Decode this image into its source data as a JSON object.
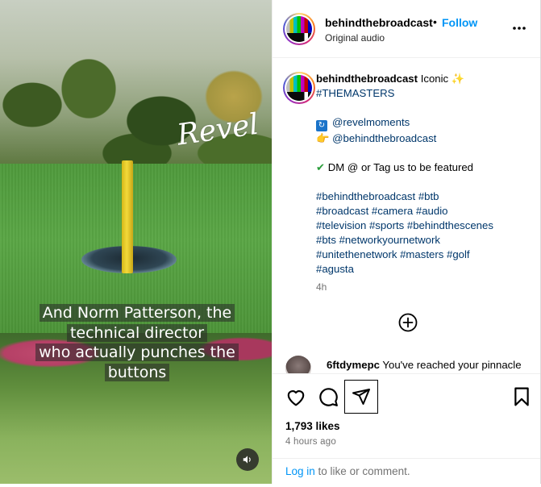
{
  "video": {
    "watermark": "Revel",
    "caption_lines": [
      "And Norm Patterson, the",
      "technical director",
      "who actually punches the",
      "buttons"
    ],
    "mute_icon": "speaker-icon"
  },
  "header": {
    "username": "behindthebroadcast",
    "separator": "•",
    "follow_label": "Follow",
    "subtitle": "Original audio",
    "more_icon": "more-options-icon"
  },
  "caption": {
    "username": "behindthebroadcast",
    "first_word": "Iconic",
    "first_emoji": "✨",
    "tag_masters": "#THEMASTERS",
    "mention_revel_emoji": "🔁",
    "mention_revel": "@revelmoments",
    "mention_btb_emoji": "👉",
    "mention_btb": "@behindthebroadcast",
    "dm_emoji": "✔",
    "dm_text": "DM @ or Tag us to be featured",
    "hashtag_lines": [
      "#behindthebroadcast #btb",
      "#broadcast #camera #audio",
      "#television #sports #behindthescenes",
      "#bts #networkyournetwork",
      "#unitethenetwork #masters #golf",
      "#agusta"
    ],
    "time": "4h"
  },
  "reply": {
    "username": "6ftdymepc",
    "text": "You've reached your pinnacle"
  },
  "actions": {
    "likes": "1,793 likes",
    "time_ago": "4 hours ago"
  },
  "login": {
    "link": "Log in",
    "rest": " to like or comment."
  },
  "colors": {
    "accent": "#0095f6",
    "link": "#00376b",
    "muted": "#737373"
  }
}
